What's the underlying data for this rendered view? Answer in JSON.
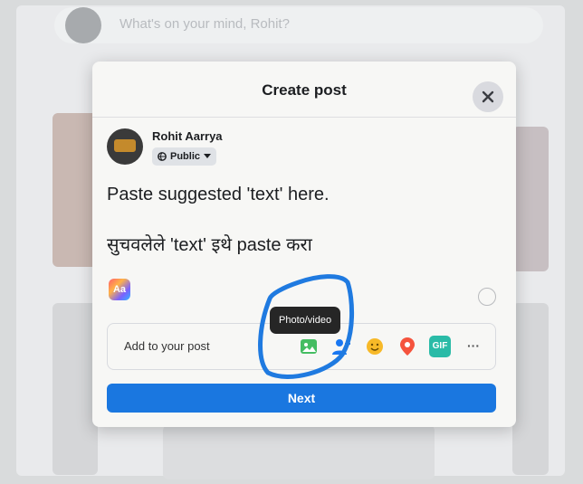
{
  "background": {
    "composer_placeholder": "What's on your mind, Rohit?"
  },
  "dialog": {
    "title": "Create post",
    "close_icon": "close-icon",
    "user": {
      "name": "Rohit Aarrya",
      "audience": "Public"
    },
    "post_text": {
      "line1": "Paste suggested 'text' here.",
      "line2": "सुचवलेले 'text' इथे paste करा"
    },
    "text_style_icon": "background-color-icon",
    "add_to_post": {
      "label": "Add to your post",
      "icons": [
        "photo-video-icon",
        "tag-people-icon",
        "feeling-icon",
        "location-icon",
        "gif-icon",
        "more-icon"
      ],
      "gif_label": "GIF",
      "more_label": "···"
    },
    "tooltip": "Photo/video",
    "next_label": "Next"
  },
  "colors": {
    "primary": "#1a77e0",
    "annotation": "#1f7ae0"
  }
}
